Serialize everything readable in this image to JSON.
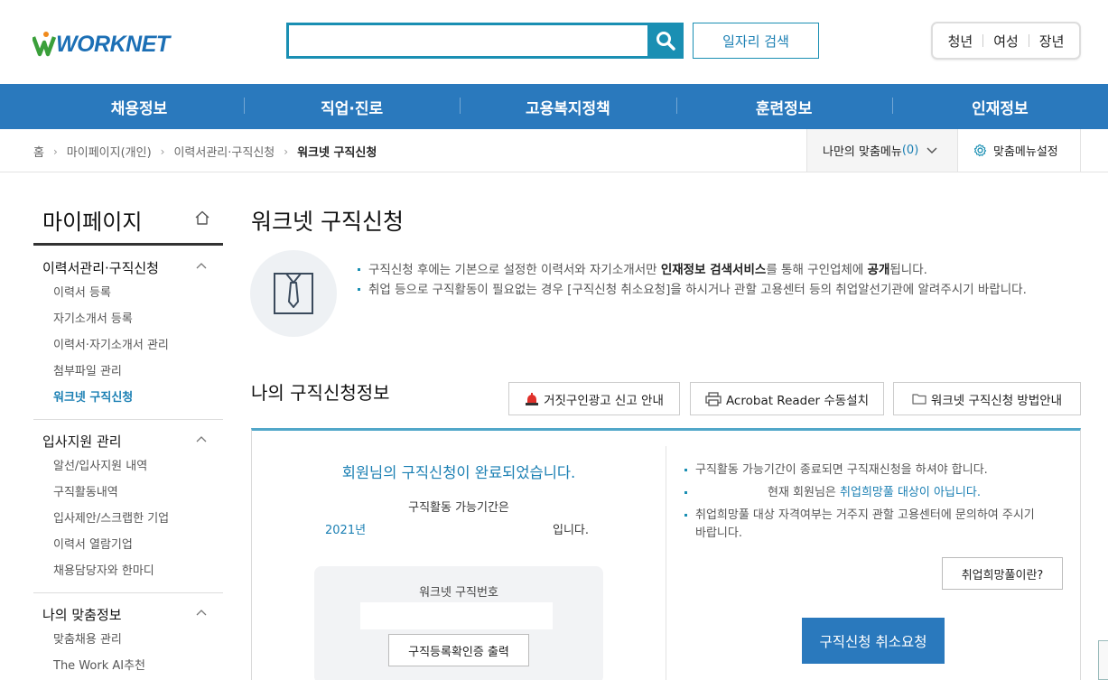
{
  "header": {
    "logo_text": "WORKNET",
    "search": {
      "placeholder": "",
      "value": ""
    },
    "job_search_label": "일자리 검색",
    "target_groups": [
      "청년",
      "여성",
      "장년"
    ]
  },
  "nav": {
    "items": [
      "채용정보",
      "직업·진로",
      "고용복지정책",
      "훈련정보",
      "인재정보"
    ]
  },
  "breadcrumb": {
    "items": [
      "홈",
      "마이페이지(개인)",
      "이력서관리·구직신청",
      "워크넷 구직신청"
    ],
    "my_menu_label": "나만의 맞춤메뉴",
    "my_menu_count": "(0)",
    "menu_setting_label": "맞춤메뉴설정"
  },
  "sidebar": {
    "title": "마이페이지",
    "sections": [
      {
        "title": "이력서관리·구직신청",
        "items": [
          "이력서 등록",
          "자기소개서 등록",
          "이력서·자기소개서 관리",
          "첨부파일 관리",
          "워크넷 구직신청"
        ]
      },
      {
        "title": "입사지원 관리",
        "items": [
          "알선/입사지원 내역",
          "구직활동내역",
          "입사제안/스크랩한 기업",
          "이력서 열람기업",
          "채용담당자와 한마디"
        ]
      },
      {
        "title": "나의 맞춤정보",
        "items": [
          "맞춤채용 관리",
          "The Work AI추천"
        ]
      }
    ]
  },
  "content": {
    "page_title": "워크넷 구직신청",
    "intro": {
      "line1_pre": "구직신청 후에는 기본으로 설정한 이력서와 자기소개서만 ",
      "line1_bold1": "인재정보 검색서비스",
      "line1_mid": "를 통해 구인업체에 ",
      "line1_bold2": "공개",
      "line1_post": "됩니다.",
      "line2": "취업 등으로 구직활동이 필요없는 경우 [구직신청 취소요청]을 하시거나 관할 고용센터 등의 취업알선기관에 알려주시기 바랍니다."
    },
    "section_title": "나의 구직신청정보",
    "tool_buttons": {
      "fake_ad": "거짓구인광고 신고 안내",
      "acrobat": "Acrobat Reader 수동설치",
      "howto": "워크넷 구직신청 방법안내"
    },
    "status": {
      "done_message": "회원님의 구직신청이 완료되었습니다.",
      "period_label": "구직활동 가능기간은",
      "period_year": "2021년",
      "period_end": "입니다.",
      "number_label": "워크넷 구직번호",
      "number_value": "",
      "print_label": "구직등록확인증 출력"
    },
    "notes": {
      "note1": "구직활동 가능기간이 종료되면 구직재신청을 하셔야 합니다.",
      "note2_pre": "현재 회원님은 ",
      "note2_hl": "취업희망풀 대상이 아닙니다.",
      "note3": "취업희망풀 대상 자격여부는 거주지 관할 고용센터에 문의하여 주시기 바랍니다.",
      "what_label": "취업희망풀이란?",
      "cancel_label": "구직신청 취소요청"
    }
  }
}
